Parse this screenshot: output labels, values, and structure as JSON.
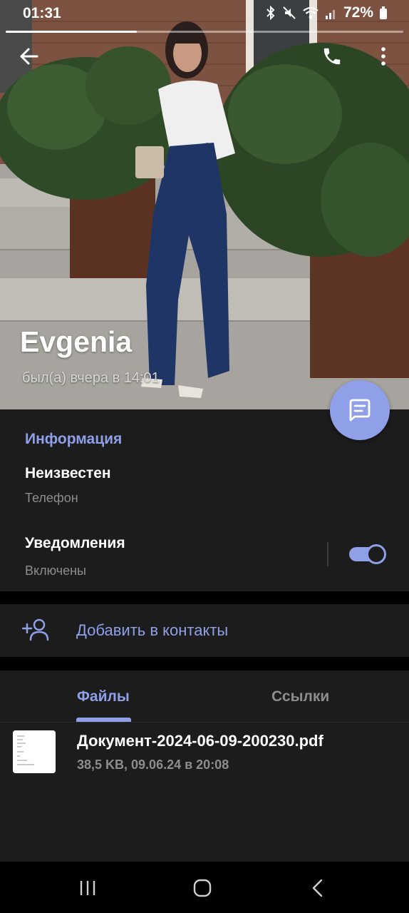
{
  "status_bar": {
    "time": "01:31",
    "battery": "72%",
    "icons": [
      "bluetooth-icon",
      "mute-icon",
      "wifi-icon",
      "signal-icon",
      "battery-icon"
    ]
  },
  "story_progress": 0.33,
  "header": {
    "back_icon": "arrow-left-icon",
    "call_icon": "phone-icon",
    "more_icon": "more-vertical-icon"
  },
  "profile": {
    "name": "Evgenia",
    "last_seen": "был(а) вчера в 14:01"
  },
  "fab": {
    "icon": "message-icon"
  },
  "info": {
    "title": "Информация",
    "phone_value": "Неизвестен",
    "phone_label": "Телефон",
    "notifications_value": "Уведомления",
    "notifications_label": "Включены",
    "notifications_enabled": true
  },
  "add_contact": {
    "label": "Добавить в контакты",
    "icon": "add-person-icon"
  },
  "media": {
    "tabs": [
      {
        "label": "Файлы",
        "active": true
      },
      {
        "label": "Ссылки",
        "active": false
      }
    ],
    "files": [
      {
        "name": "Документ-2024-06-09-200230.pdf",
        "meta": "38,5 KB, 09.06.24 в 20:08"
      }
    ]
  },
  "navbar": {
    "icons": [
      "recents-icon",
      "home-icon",
      "back-nav-icon"
    ]
  },
  "colors": {
    "accent": "#8f9fe8",
    "panel": "#1c1c1c",
    "secondary_text": "#8d8d8d"
  }
}
